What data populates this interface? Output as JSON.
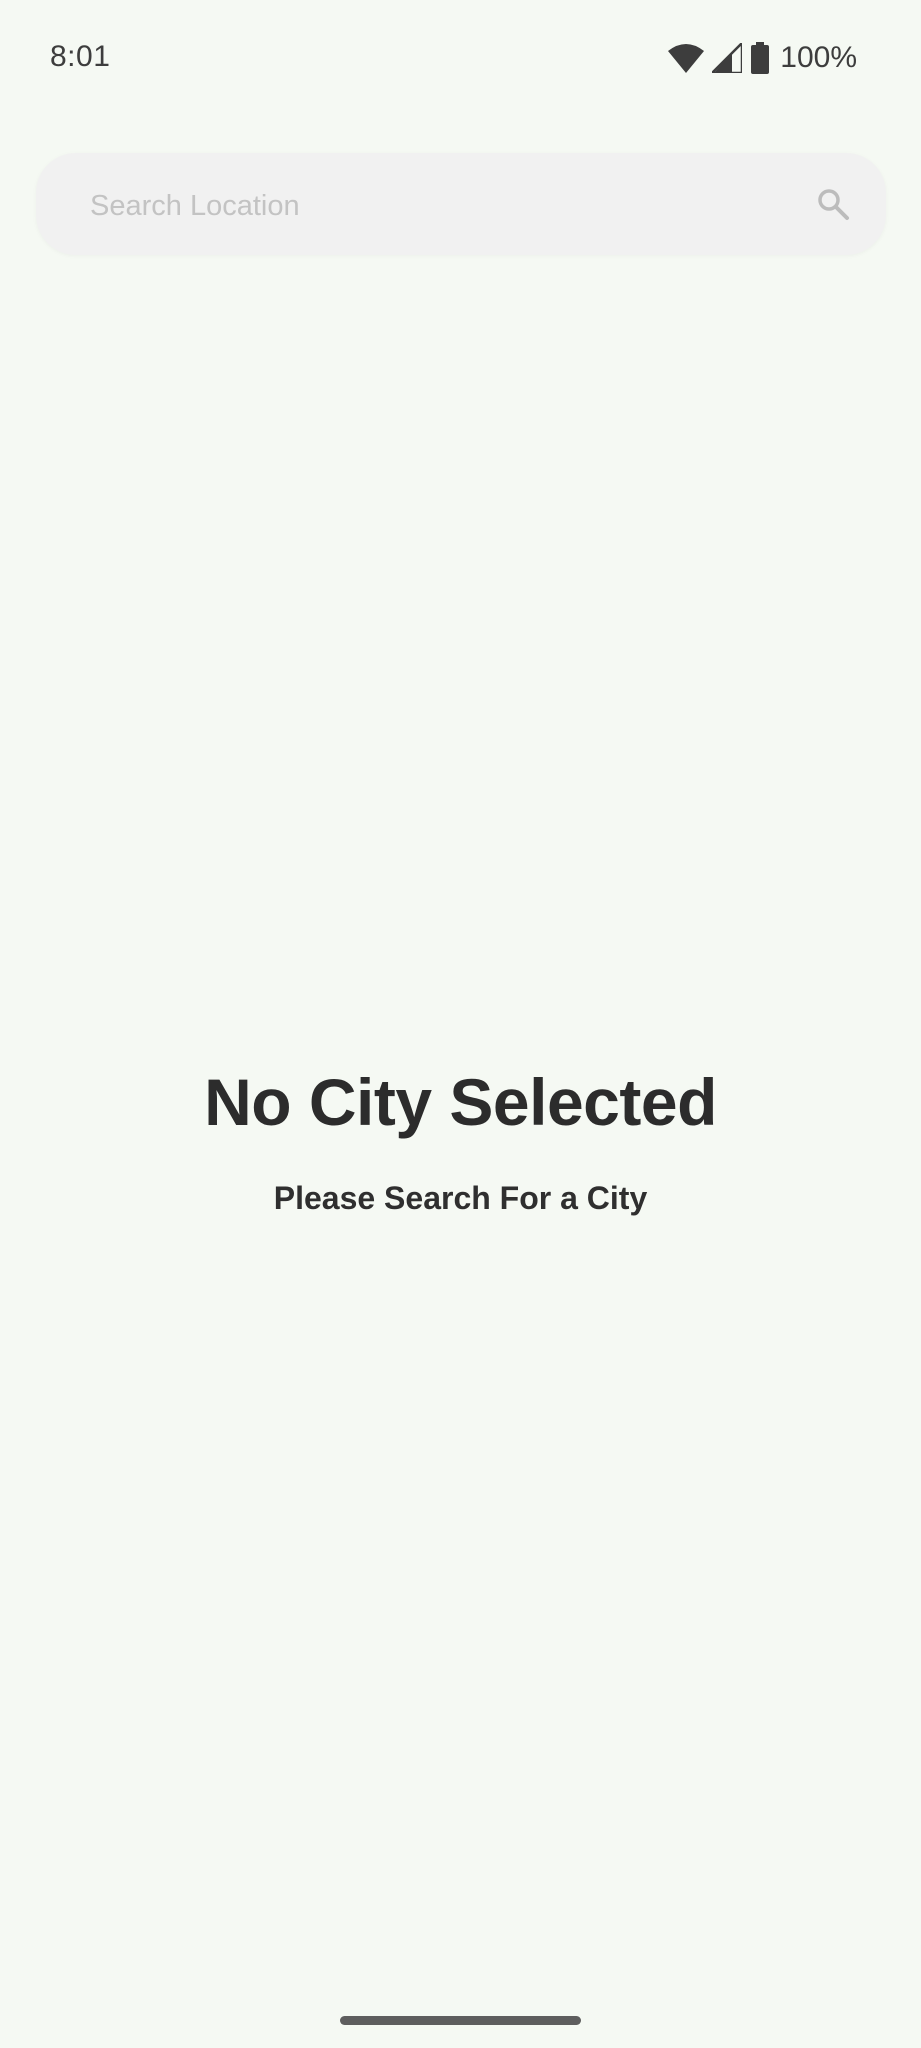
{
  "status_bar": {
    "time": "8:01",
    "battery_percent": "100%",
    "icons": [
      "wifi-icon",
      "cell-signal-icon",
      "battery-icon"
    ]
  },
  "search": {
    "placeholder": "Search Location",
    "value": "",
    "icon": "search-icon"
  },
  "empty_state": {
    "title": "No City Selected",
    "subtitle": "Please Search For a City"
  },
  "colors": {
    "background": "#f5f9f3",
    "search_bar": "#f1f1f1",
    "text": "#2c2c2c",
    "placeholder": "#c3c3c3"
  }
}
